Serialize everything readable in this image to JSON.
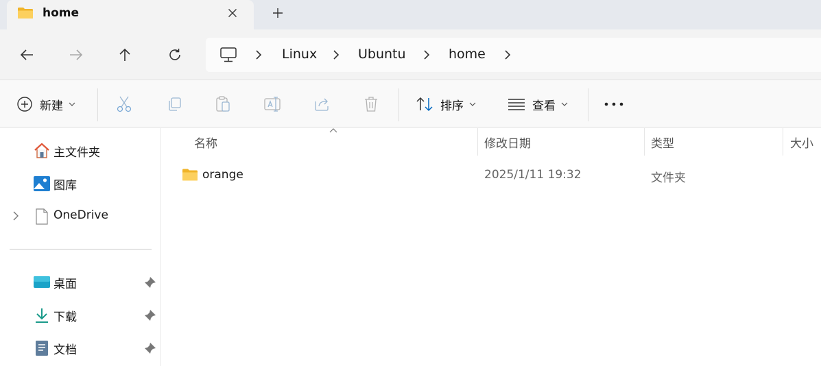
{
  "tab": {
    "title": "home",
    "close_icon": "close-icon",
    "new_tab_icon": "plus-icon"
  },
  "nav": {
    "back_icon": "arrow-left-icon",
    "forward_icon": "arrow-right-icon",
    "up_icon": "arrow-up-icon",
    "refresh_icon": "refresh-icon"
  },
  "address": {
    "root_icon": "this-pc-icon",
    "crumbs": [
      "Linux",
      "Ubuntu",
      "home"
    ]
  },
  "toolbar": {
    "new_label": "新建",
    "sort_label": "排序",
    "view_label": "查看",
    "icons": [
      "cut-icon",
      "copy-icon",
      "paste-icon",
      "rename-icon",
      "share-icon",
      "delete-icon",
      "more-icon"
    ]
  },
  "sidebar": {
    "items": [
      {
        "label": "主文件夹",
        "icon": "home-icon"
      },
      {
        "label": "图库",
        "icon": "gallery-icon"
      },
      {
        "label": "OneDrive",
        "icon": "onedrive-icon"
      },
      {
        "label": "桌面",
        "icon": "desktop-icon",
        "pinned": true
      },
      {
        "label": "下载",
        "icon": "download-icon",
        "pinned": true
      },
      {
        "label": "文档",
        "icon": "documents-icon",
        "pinned": true
      }
    ]
  },
  "columns": {
    "name": "名称",
    "date": "修改日期",
    "type": "类型",
    "size": "大小"
  },
  "files": [
    {
      "name": "orange",
      "date": "2025/1/11 19:32",
      "type": "文件夹",
      "icon": "folder-icon"
    }
  ],
  "colors": {
    "folder": "#f8c640",
    "accent": "#0067c0",
    "tabstrip": "#e6e9ee",
    "chrome": "#f3f3f3"
  }
}
